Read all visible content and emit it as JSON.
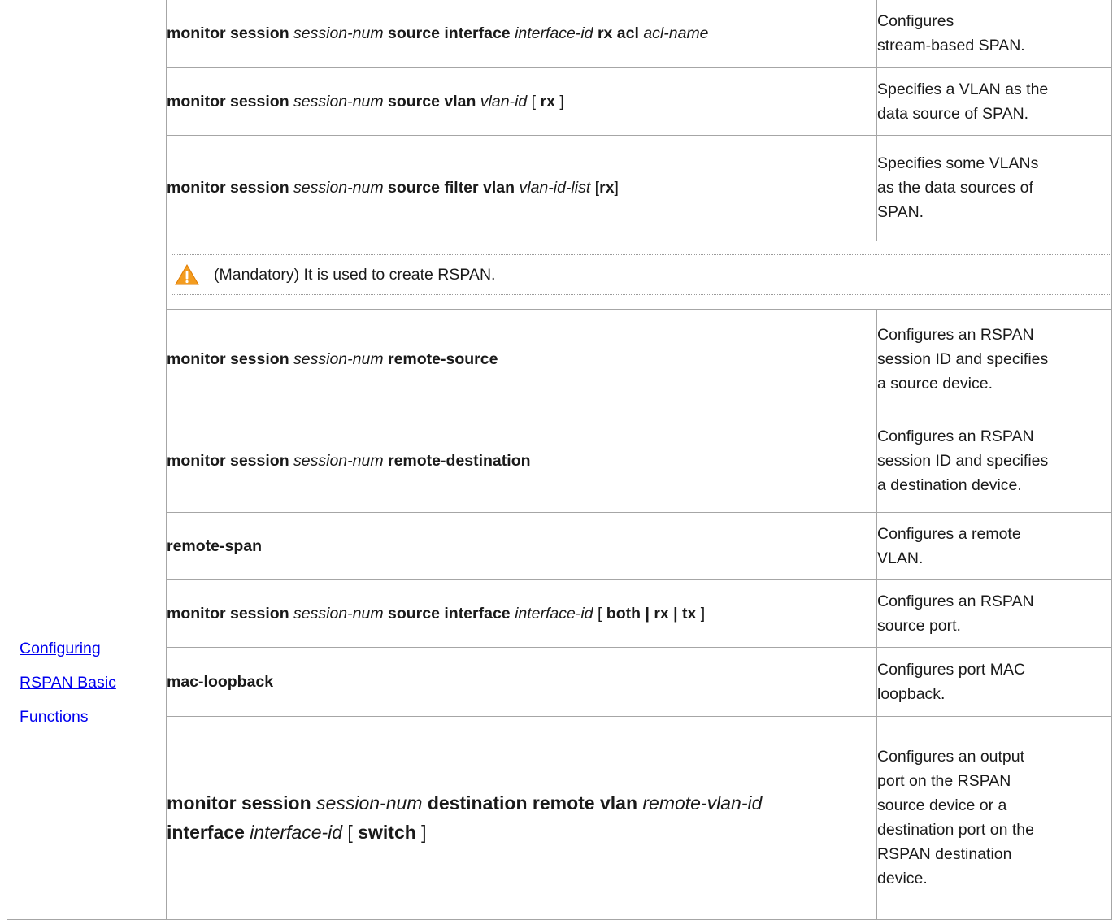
{
  "rows_top": [
    {
      "cmd": [
        {
          "t": "monitor session ",
          "s": "b"
        },
        {
          "t": "session-num",
          "s": "i"
        },
        {
          "t": " source interface ",
          "s": "b"
        },
        {
          "t": "interface-id",
          "s": "i"
        },
        {
          "t": " rx acl ",
          "s": "b"
        },
        {
          "t": "acl-name",
          "s": "i"
        }
      ],
      "desc": "Configures\nstream-based SPAN."
    },
    {
      "cmd": [
        {
          "t": "monitor session ",
          "s": "b"
        },
        {
          "t": "session-num",
          "s": "i"
        },
        {
          "t": " source vlan ",
          "s": "b"
        },
        {
          "t": "vlan-id",
          "s": "i"
        },
        {
          "t": " [ ",
          "s": "n"
        },
        {
          "t": "rx",
          "s": "b"
        },
        {
          "t": " ]",
          "s": "n"
        }
      ],
      "desc": "Specifies a VLAN as the\ndata source of SPAN."
    },
    {
      "cmd": [
        {
          "t": "monitor session ",
          "s": "b"
        },
        {
          "t": "session-num",
          "s": "i"
        },
        {
          "t": " source filter vlan ",
          "s": "b"
        },
        {
          "t": "vlan-id-list",
          "s": "i"
        },
        {
          "t": " [",
          "s": "n"
        },
        {
          "t": "rx",
          "s": "b"
        },
        {
          "t": "]",
          "s": "n"
        }
      ],
      "desc": "Specifies some VLANs\nas the data sources of\nSPAN."
    }
  ],
  "feature": {
    "label_lines": [
      "Configuring ",
      "RSPAN Basic ",
      "Functions"
    ]
  },
  "note": {
    "icon": "warning-icon",
    "text": "(Mandatory) It is used to create RSPAN."
  },
  "rows_rspan": [
    {
      "cmd": [
        {
          "t": "monitor session ",
          "s": "b"
        },
        {
          "t": "session-num",
          "s": "i"
        },
        {
          "t": " remote-source",
          "s": "b"
        }
      ],
      "desc": "Configures an RSPAN\nsession ID and specifies\na source device."
    },
    {
      "cmd": [
        {
          "t": "monitor session ",
          "s": "b"
        },
        {
          "t": "session-num",
          "s": "i"
        },
        {
          "t": " remote-destination",
          "s": "b"
        }
      ],
      "desc": "Configures an RSPAN\nsession ID and specifies\na destination device."
    },
    {
      "cmd": [
        {
          "t": "remote-span",
          "s": "b"
        }
      ],
      "desc": "Configures a remote\nVLAN."
    },
    {
      "cmd": [
        {
          "t": "monitor session ",
          "s": "b"
        },
        {
          "t": "session-num",
          "s": "i"
        },
        {
          "t": " source interface ",
          "s": "b"
        },
        {
          "t": "interface-id",
          "s": "i"
        },
        {
          "t": " [ ",
          "s": "n"
        },
        {
          "t": "both | rx | tx",
          "s": "b"
        },
        {
          "t": " ]",
          "s": "n"
        }
      ],
      "desc": "Configures an RSPAN\nsource port."
    },
    {
      "cmd": [
        {
          "t": "mac-loopback",
          "s": "b"
        }
      ],
      "desc": "Configures port MAC\nloopback."
    },
    {
      "cmd": [
        {
          "t": "monitor session ",
          "s": "b"
        },
        {
          "t": "session-num",
          "s": "i"
        },
        {
          "t": " destination remote vlan ",
          "s": "b"
        },
        {
          "t": "remote-vlan-id",
          "s": "i"
        },
        {
          "t": "\n",
          "s": "br"
        },
        {
          "t": "interface ",
          "s": "b"
        },
        {
          "t": "interface-id",
          "s": "i"
        },
        {
          "t": " [ ",
          "s": "n"
        },
        {
          "t": "switch",
          "s": "b"
        },
        {
          "t": " ]",
          "s": "n"
        }
      ],
      "big": true,
      "desc": "Configures an output\nport on the RSPAN\nsource device or a\ndestination port on the\nRSPAN destination\ndevice."
    }
  ]
}
